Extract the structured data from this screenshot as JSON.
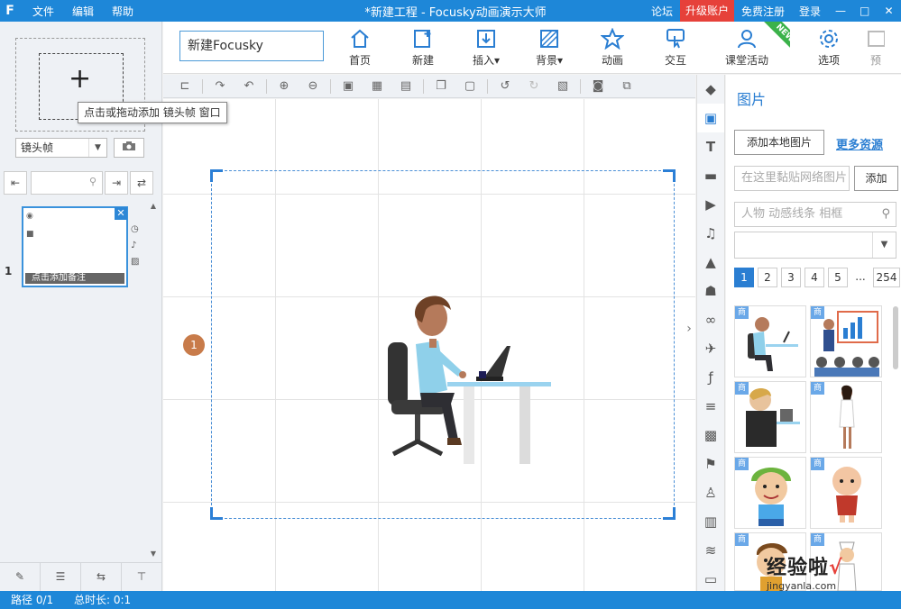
{
  "app": {
    "title": "*新建工程 - Focusky动画演示大师",
    "menu": [
      "文件",
      "编辑",
      "帮助"
    ],
    "right_links": {
      "forum": "论坛",
      "upgrade": "升级账户",
      "register": "免费注册",
      "login": "登录"
    },
    "window": {
      "min": "—",
      "max": "□",
      "close": "✕"
    }
  },
  "left": {
    "tooltip": "点击或拖动添加 镜头帧 窗口",
    "frame_type": "镜头帧",
    "slide_number": "1",
    "slide_note": "点击添加备注"
  },
  "toolbar": {
    "project_name": "新建Focusky",
    "items": {
      "home": "首页",
      "new": "新建",
      "insert": "插入",
      "background": "背景",
      "animation": "动画",
      "interaction": "交互",
      "class_activity": "课堂活动",
      "options": "选项",
      "preview": "预"
    },
    "new_badge": "NEW"
  },
  "canvas": {
    "frame_number": "1"
  },
  "right": {
    "title": "图片",
    "add_local": "添加本地图片",
    "more": "更多资源",
    "paste_placeholder": "在这里黏贴网络图片",
    "add": "添加",
    "search_placeholder": "人物 动感线条 相框",
    "pages": [
      "1",
      "2",
      "3",
      "4",
      "5",
      "...",
      "254"
    ],
    "current_page": "1",
    "commercial_tag": "商"
  },
  "status": {
    "path": "路径 0/1",
    "duration": "总时长: 0:1"
  },
  "watermark": {
    "cn": "经验啦",
    "check": "√",
    "url": "jingyanla.com"
  },
  "colors": {
    "accent": "#1e87d8",
    "upgrade": "#e6413a",
    "frame_border": "#2b7fd6"
  }
}
